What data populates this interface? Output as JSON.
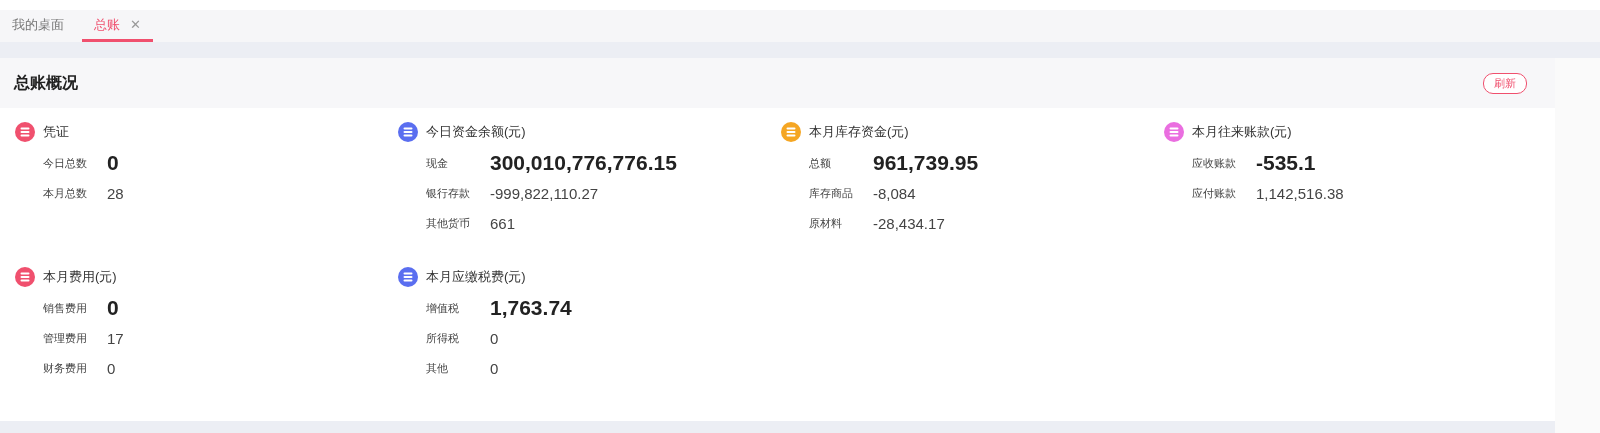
{
  "tabs": [
    {
      "label": "我的桌面",
      "selected": false,
      "closable": false
    },
    {
      "label": "总账",
      "selected": true,
      "closable": true,
      "close_glyph": "✕"
    }
  ],
  "panel": {
    "title": "总账概况",
    "refresh_button": "刷新",
    "groups": [
      {
        "title": "凭证",
        "color": "#f0506e",
        "items": [
          {
            "label": "今日总数",
            "value": "0",
            "kind": "primary"
          },
          {
            "label": "本月总数",
            "value": "28",
            "kind": "plain"
          }
        ]
      },
      {
        "title": "今日资金余额(元)",
        "color": "#5a6ef0",
        "items": [
          {
            "label": "现金",
            "value": "300,010,776,776.15",
            "kind": "primary"
          },
          {
            "label": "银行存款",
            "value": "-999,822,110.27",
            "kind": "plain"
          },
          {
            "label": "其他货币",
            "value": "661",
            "kind": "plain"
          }
        ]
      },
      {
        "title": "本月库存资金(元)",
        "color": "#f5a623",
        "items": [
          {
            "label": "总额",
            "value": "961,739.95",
            "kind": "primary"
          },
          {
            "label": "库存商品",
            "value": "-8,084",
            "kind": "plain"
          },
          {
            "label": "原材料",
            "value": "-28,434.17",
            "kind": "plain"
          }
        ]
      },
      {
        "title": "本月往来账款(元)",
        "color": "#ea6ee0",
        "items": [
          {
            "label": "应收账款",
            "value": "-535.1",
            "kind": "primary"
          },
          {
            "label": "应付账款",
            "value": "1,142,516.38",
            "kind": "plain"
          }
        ]
      },
      {
        "title": "本月费用(元)",
        "color": "#f0506e",
        "items": [
          {
            "label": "销售费用",
            "value": "0",
            "kind": "primary"
          },
          {
            "label": "管理费用",
            "value": "17",
            "kind": "plain"
          },
          {
            "label": "财务费用",
            "value": "0",
            "kind": "plain"
          }
        ]
      },
      {
        "title": "本月应缴税费(元)",
        "color": "#5a6ef0",
        "items": [
          {
            "label": "增值税",
            "value": "1,763.74",
            "kind": "primary"
          },
          {
            "label": "所得税",
            "value": "0",
            "kind": "plain"
          },
          {
            "label": "其他",
            "value": "0",
            "kind": "plain"
          }
        ]
      }
    ]
  }
}
